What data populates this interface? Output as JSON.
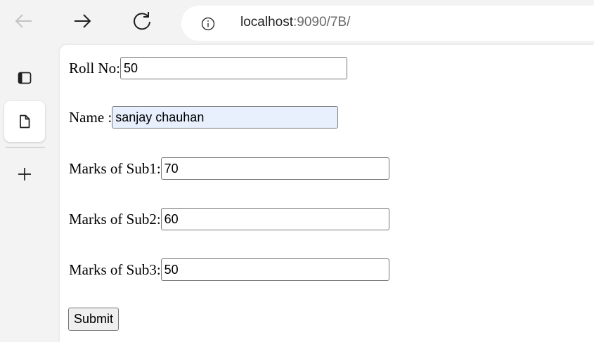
{
  "browser": {
    "url_host": "localhost",
    "url_rest": ":9090/7B/",
    "icons": {
      "back": "arrow-left-icon",
      "forward": "arrow-right-icon",
      "reload": "reload-icon",
      "info": "info-icon",
      "tabs": "tab-actions-icon",
      "page": "page-icon",
      "add": "plus-icon"
    }
  },
  "form": {
    "roll": {
      "label": "Roll No:",
      "value": "50"
    },
    "name": {
      "label": "Name :",
      "value": "sanjay chauhan"
    },
    "sub1": {
      "label": "Marks of Sub1:",
      "value": "70"
    },
    "sub2": {
      "label": "Marks of Sub2:",
      "value": "60"
    },
    "sub3": {
      "label": "Marks of Sub3:",
      "value": "50"
    },
    "submit_label": "Submit"
  },
  "colors": {
    "autofill_background": "#e8f0fe",
    "chrome_background": "#f3f3f3",
    "page_background": "#ffffff"
  }
}
